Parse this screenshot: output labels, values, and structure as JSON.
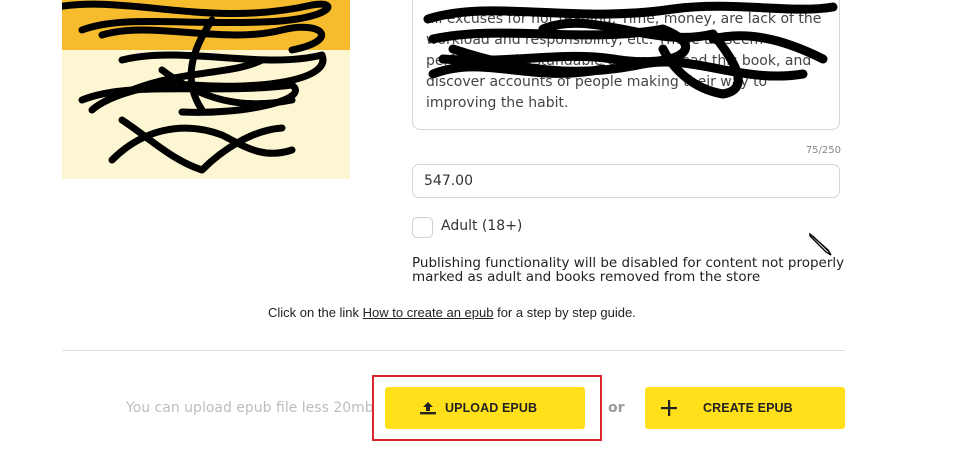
{
  "description": {
    "text": "all excuses for not reading. Time, money, are lack of the workload and responsibility, etc. These all seem perfectly understandable excuses. Read this book, and discover accounts of people making their way to improving the habit.",
    "counter": "75/250"
  },
  "price": {
    "value": "547.00"
  },
  "adult": {
    "label": "Adult (18+)",
    "checked": false,
    "note": "Publishing functionality will be disabled for content not properly marked as adult and books removed from the store"
  },
  "guide": {
    "prefix": "Click on the link ",
    "link": "How to create an epub",
    "suffix": " for a step by step guide."
  },
  "upload": {
    "note": "You can upload epub file less 20mb",
    "upload_button": "UPLOAD EPUB",
    "or": "or",
    "create_button": "CREATE EPUB",
    "upload_icon": "upload-icon",
    "create_icon": "plus-icon"
  },
  "colors": {
    "button": "#ffe01b",
    "highlight": "#d9262c",
    "cover_band": "#f7bc2e",
    "cover_bg": "#fdf6d2"
  }
}
